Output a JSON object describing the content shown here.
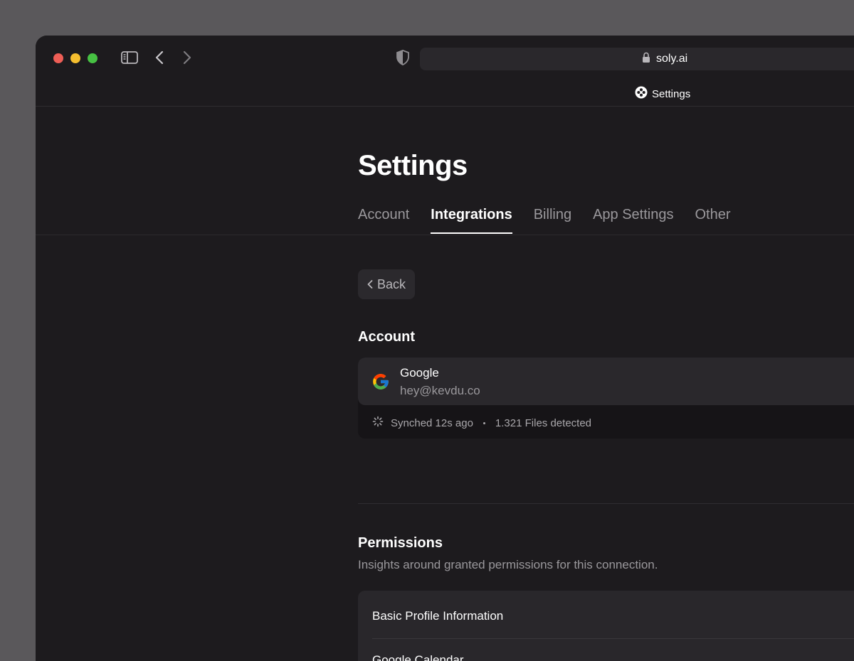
{
  "browser": {
    "url": "soly.ai",
    "tab_title": "Settings"
  },
  "page": {
    "title": "Settings",
    "tabs": [
      {
        "label": "Account",
        "active": false
      },
      {
        "label": "Integrations",
        "active": true
      },
      {
        "label": "Billing",
        "active": false
      },
      {
        "label": "App Settings",
        "active": false
      },
      {
        "label": "Other",
        "active": false
      }
    ],
    "back_label": "Back"
  },
  "account": {
    "heading": "Account",
    "provider": "Google",
    "email": "hey@kevdu.co",
    "sync_status": "Synched 12s ago",
    "files_detected": "1.321 Files detected"
  },
  "permissions": {
    "heading": "Permissions",
    "subtitle": "Insights around granted permissions for this connection.",
    "items": [
      {
        "label": "Basic Profile Information"
      },
      {
        "label": "Google Calendar"
      }
    ]
  },
  "colors": {
    "window_bg": "#1d1b1e",
    "card_bg": "#2a282c",
    "muted_text": "#9a989c",
    "accent_text": "#ffffff"
  }
}
